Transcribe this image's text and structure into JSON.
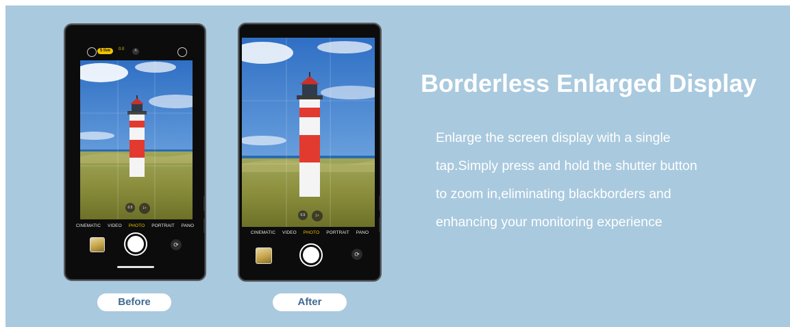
{
  "headline": "Borderless Enlarged Display",
  "description_lines": [
    "Enlarge the screen display with a single",
    "tap.Simply press and hold the shutter button",
    "to zoom in,eliminating blackborders and",
    "enhancing your monitoring experience"
  ],
  "before_label": "Before",
  "after_label": "After",
  "camera": {
    "modes": [
      "CINEMATIC",
      "VIDEO",
      "PHOTO",
      "PORTRAIT",
      "PANO"
    ],
    "active_mode": "PHOTO",
    "zoom_options": [
      "0.5",
      "1×"
    ],
    "live_badge": "5 live",
    "exposure": "0.0"
  },
  "colors": {
    "background": "#a9c9de",
    "pill_text": "#3f6a92",
    "mode_active": "#f2c200"
  }
}
